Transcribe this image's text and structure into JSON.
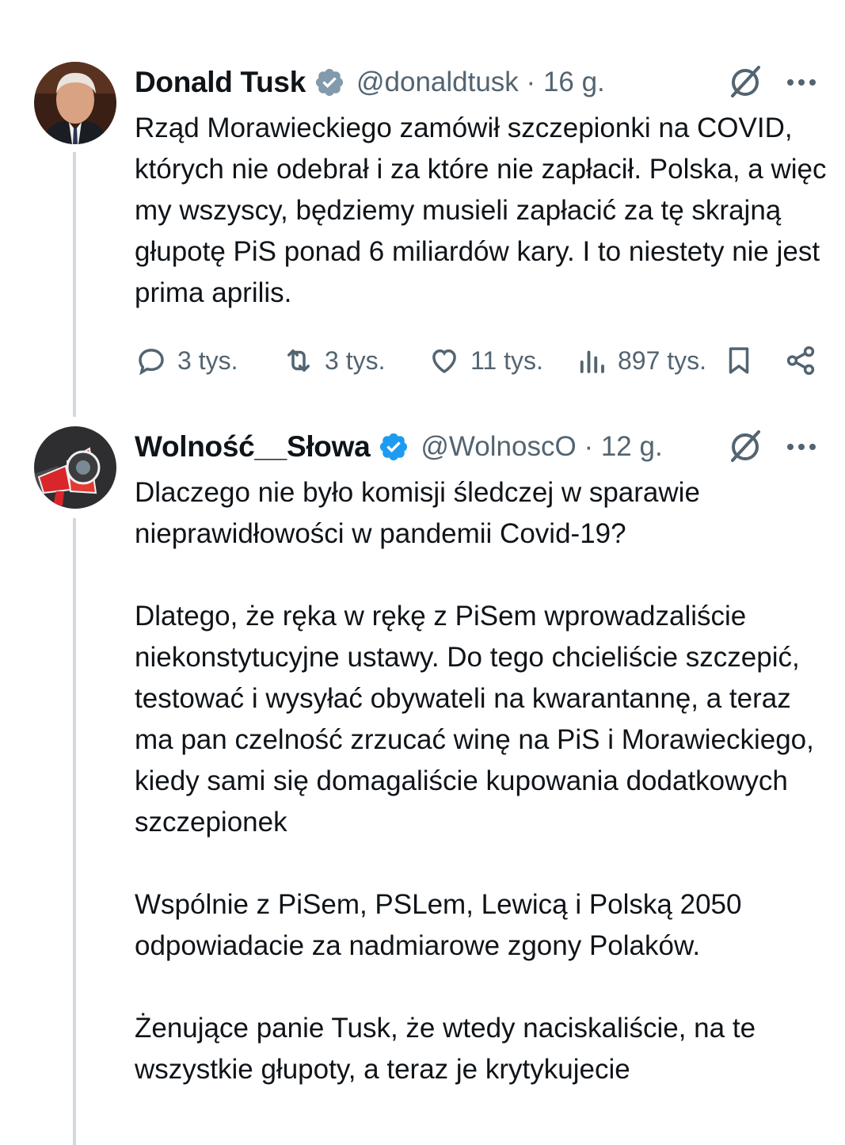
{
  "tweets": [
    {
      "author_name": "Donald Tusk",
      "handle": "@donaldtusk",
      "separator": "·",
      "time": "16 g.",
      "verified": "gray",
      "text": "Rząd Morawieckiego zamówił szczepionki na COVID, których nie odebrał i za które nie zapłacił. Polska, a więc my wszyscy, będziemy musieli zapłacić za tę skrajną głupotę PiS ponad 6 miliardów kary. I to niestety nie jest prima aprilis.",
      "metrics": {
        "replies": "3 tys.",
        "reposts": "3 tys.",
        "likes": "11 tys.",
        "views": "897 tys."
      }
    },
    {
      "author_name": "Wolność__Słowa",
      "handle": "@WolnoscO",
      "separator": "·",
      "time": "12 g.",
      "verified": "blue",
      "text": "Dlaczego nie było komisji śledczej w sparawie nieprawidłowości w pandemii Covid-19?\n\nDlatego, że ręka w rękę z PiSem wprowadzaliście niekonstytucyjne ustawy. Do tego chcieliście szczepić, testować i wysyłać obywateli na kwarantannę, a teraz ma pan czelność zrzucać winę na PiS i Morawieckiego, kiedy sami się domagaliście kupowania dodatkowych szczepionek\n\nWspólnie z PiSem, PSLem, Lewicą i Polską 2050 odpowiadacie za nadmiarowe zgony Polaków.\n\nŻenujące panie Tusk, że wtedy naciskaliście, na te wszystkie głupoty, a teraz je krytykujecie"
    }
  ],
  "colors": {
    "text": "#0f1419",
    "secondary": "#536471",
    "thread_line": "#cfd9de",
    "verified_gray": "#829aab",
    "verified_blue": "#1d9bf0"
  }
}
